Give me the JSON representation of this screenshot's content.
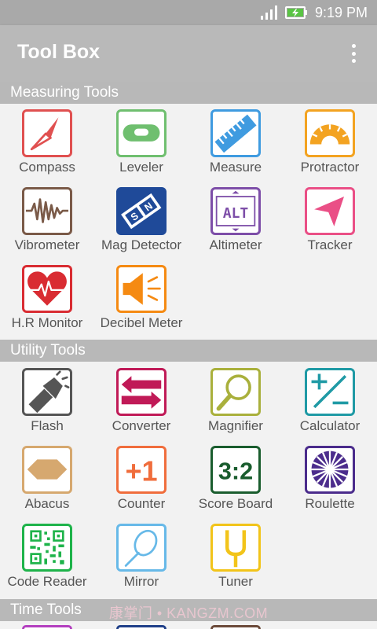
{
  "status_bar": {
    "time": "9:19 PM"
  },
  "app_bar": {
    "title": "Tool Box"
  },
  "sections": {
    "measuring": {
      "title": "Measuring Tools",
      "tools": [
        "Compass",
        "Leveler",
        "Measure",
        "Protractor",
        "Vibrometer",
        "Mag Detector",
        "Altimeter",
        "Tracker",
        "H.R Monitor",
        "Decibel Meter"
      ]
    },
    "utility": {
      "title": "Utility Tools",
      "tools": [
        "Flash",
        "Converter",
        "Magnifier",
        "Calculator",
        "Abacus",
        "Counter",
        "Score Board",
        "Roulette",
        "Code Reader",
        "Mirror",
        "Tuner"
      ]
    },
    "time": {
      "title": "Time Tools"
    }
  },
  "icon_text": {
    "altimeter": "ALT",
    "counter": "+1",
    "score_board": "3:2"
  },
  "watermark": "康掌门 • KANGZM.COM",
  "colors": {
    "compass": "#e05050",
    "leveler": "#6fbf6f",
    "measure": "#3f9be0",
    "protractor": "#f3a321",
    "vibrometer": "#7a5a48",
    "mag_detector": "#1f4a99",
    "altimeter": "#7d4ea8",
    "tracker": "#ea4f86",
    "hr_monitor": "#d92c32",
    "decibel": "#f58a12",
    "flash": "#555555",
    "converter": "#c01a57",
    "magnifier": "#a9b03c",
    "calculator": "#1f9aa5",
    "abacus": "#d6a86f",
    "counter": "#f06d3c",
    "score_board": "#1a5d2e",
    "roulette": "#4b2c8c",
    "code_reader": "#1eb34a",
    "mirror": "#67b9e8",
    "tuner": "#f2c41a"
  }
}
